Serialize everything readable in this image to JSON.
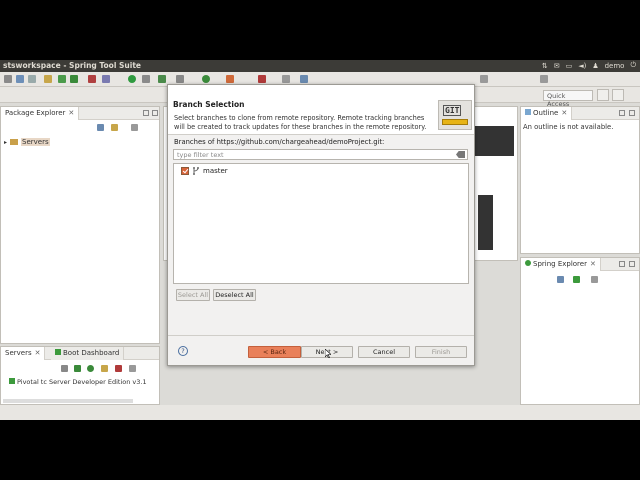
{
  "window": {
    "title": "stsworkspace - Spring Tool Suite",
    "user": "demo"
  },
  "toolbar": {
    "quick_access_placeholder": "Quick Access"
  },
  "package_explorer": {
    "tab_label": "Package Explorer",
    "close": "✕",
    "tree": [
      {
        "label": "Servers"
      }
    ]
  },
  "outline": {
    "tab_label": "Outline",
    "close": "✕",
    "message": "An outline is not available."
  },
  "spring_explorer": {
    "tab_label": "Spring Explorer",
    "close": "✕"
  },
  "servers": {
    "tab_label": "Servers",
    "close": "✕",
    "boot_dashboard_label": "Boot Dashboard",
    "item": "Pivotal tc Server Developer Edition v3.1"
  },
  "dialog": {
    "title": "Branch Selection",
    "description": "Select branches to clone from remote repository. Remote tracking branches will be created to track updates for these branches in the remote repository.",
    "logo_text": "GIT",
    "branches_label": "Branches of https://github.com/chargeahead/demoProject.git:",
    "filter_placeholder": "type filter text",
    "branches": [
      {
        "name": "master",
        "checked": true
      }
    ],
    "select_all": "Select All",
    "deselect_all": "Deselect All",
    "help": "?",
    "back": "< Back",
    "next": "Next >",
    "cancel": "Cancel",
    "finish": "Finish"
  },
  "colors": {
    "accent": "#e9805a",
    "titlebar": "#3c3b37",
    "checkbox": "#d9643a"
  }
}
